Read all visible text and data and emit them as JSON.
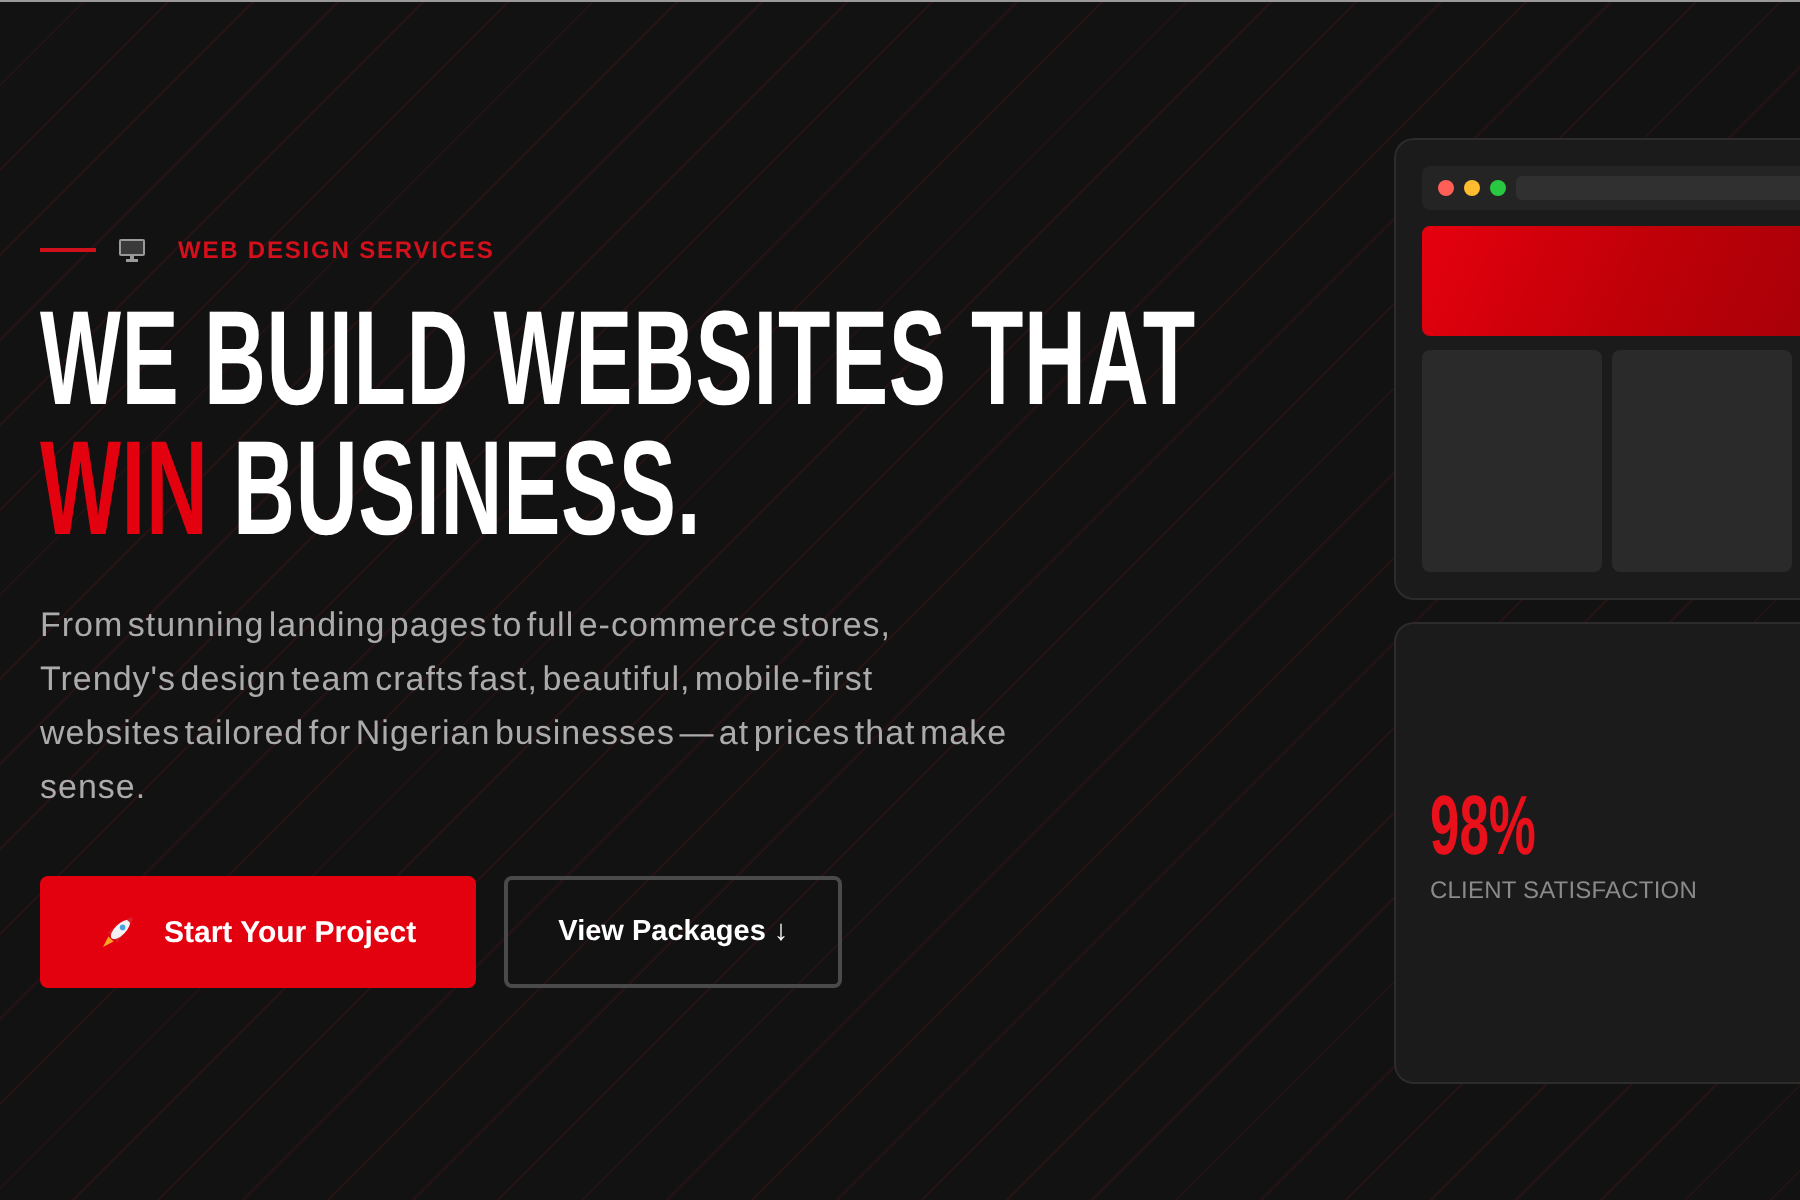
{
  "hero": {
    "eyebrow": "WEB DESIGN SERVICES",
    "title": {
      "line_1": "WE BUILD WEBSITES THAT",
      "highlight": "WIN",
      "line_2": "BUSINESS."
    },
    "description": "From stunning landing pages to full e-commerce stores, Trendy's design team crafts fast, beautiful, mobile-first websites tailored for Nigerian businesses — at prices that make sense.",
    "buttons": [
      {
        "kind": "primary",
        "label": "Start Your Project"
      },
      {
        "kind": "outline",
        "label": "View Packages ↓"
      }
    ]
  },
  "stat_card": {
    "value": "98%",
    "label": "CLIENT SATISFACTION"
  }
}
